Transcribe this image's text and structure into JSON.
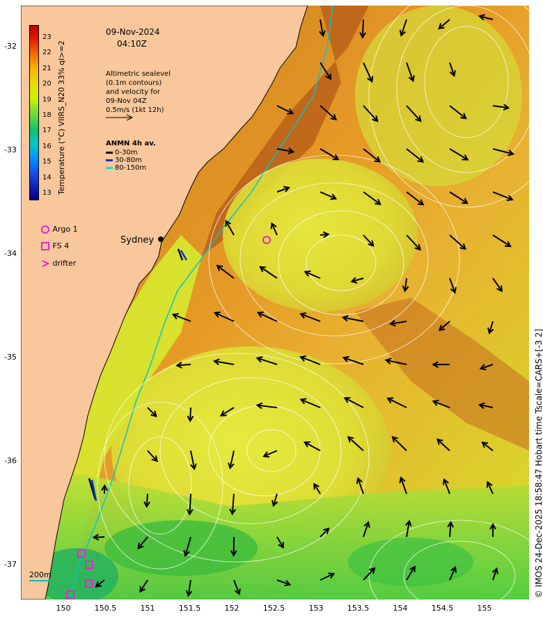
{
  "date": "09-Nov-2024",
  "time": "04:10Z",
  "info_lines": [
    "Altimetric sealevel",
    "(0.1m contours)",
    "and velocity for",
    "09-Nov 04Z",
    "0.5m/s (1kt 12h)"
  ],
  "anmn": {
    "title": "ANMN 4h av.",
    "rows": [
      {
        "label": "0-30m",
        "color": "#000000"
      },
      {
        "label": "30-80m",
        "color": "#0033cc"
      },
      {
        "label": "80-150m",
        "color": "#00e5e5"
      }
    ]
  },
  "colorbar": {
    "title": "Temperature (°C) VIIRS_N20 33% ql>=2",
    "ticks": [
      "23",
      "22",
      "21",
      "20",
      "19",
      "18",
      "17",
      "16",
      "15",
      "14",
      "13"
    ]
  },
  "legend": {
    "argo": "Argo 1",
    "fs": "FS 4",
    "drifter": "drifter",
    "marker_color": "#ee22cc"
  },
  "sydney_label": "Sydney",
  "depth_label": "200m",
  "credit": "© IMOS 24-Dec-2025 18:58:47 Hobart time Tscale=CARS+[-3 2]",
  "lat_ticks": [
    "-32",
    "-33",
    "-34",
    "-35",
    "-36",
    "-37"
  ],
  "lon_ticks": [
    "150",
    "150.5",
    "151",
    "151.5",
    "152",
    "152.5",
    "153",
    "153.5",
    "154",
    "154.5",
    "155"
  ],
  "colors": {
    "land": "#f8c79b",
    "coast": "#000000",
    "shelf": "#00c8c8",
    "arrow": "#000000"
  }
}
